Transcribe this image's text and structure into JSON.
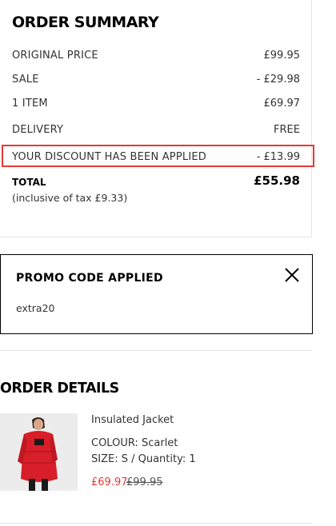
{
  "order_summary": {
    "title": "ORDER SUMMARY",
    "rows": [
      {
        "label": "ORIGINAL PRICE",
        "value": "£99.95"
      },
      {
        "label": "SALE",
        "value": "- £29.98"
      },
      {
        "label": "1 ITEM",
        "value": "£69.97"
      },
      {
        "label": "DELIVERY",
        "value": "FREE"
      },
      {
        "label": "YOUR DISCOUNT HAS BEEN APPLIED",
        "value": "- £13.99"
      }
    ],
    "total_label": "TOTAL",
    "total_value": "£55.98",
    "tax_line": "(inclusive of tax  £9.33)",
    "highlight_color": "#e53935"
  },
  "promo": {
    "title": "PROMO CODE APPLIED",
    "code": "extra20",
    "close_icon": "close-icon"
  },
  "order_details": {
    "title": "ORDER DETAILS",
    "product": {
      "name": "Insulated Jacket",
      "colour": "COLOUR: Scarlet",
      "size_quantity": "SIZE: S / Quantity: 1",
      "price": "£69.97",
      "original_price": "£99.95",
      "image_alt": "red-jacket-product-image"
    }
  }
}
